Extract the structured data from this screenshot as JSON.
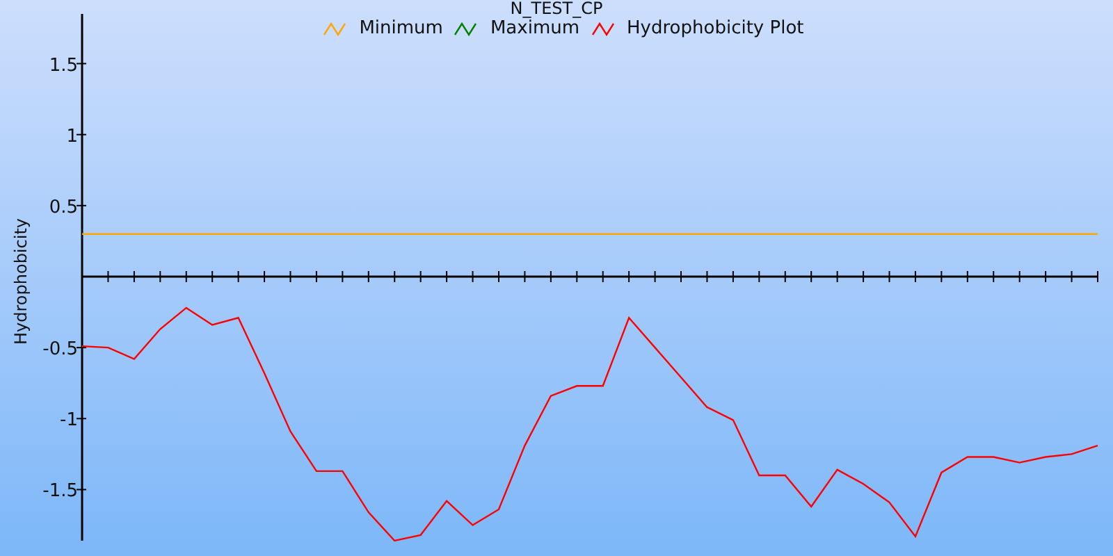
{
  "chart": {
    "chart_data": {
      "type": "line",
      "title": "N_TEST_CP",
      "ylabel": "Hydrophobicity",
      "categories": [
        null,
        null,
        null,
        null,
        null,
        null,
        null,
        null,
        null,
        null,
        null,
        null,
        null,
        null,
        null,
        null,
        null,
        null,
        null,
        null,
        null,
        null,
        null,
        null,
        null,
        null,
        null,
        null,
        null,
        null,
        null,
        null,
        null,
        null,
        null,
        null,
        null,
        null,
        null,
        null
      ],
      "ylim": [
        -1.86,
        1.85
      ],
      "yticks": [
        {
          "value": -1.5,
          "label": "-1.5"
        },
        {
          "value": -1,
          "label": "-1"
        },
        {
          "value": -0.5,
          "label": "-0.5"
        },
        {
          "value": 0.5,
          "label": "0.5"
        },
        {
          "value": 1,
          "label": "1"
        },
        {
          "value": 1.5,
          "label": "1.5"
        }
      ],
      "series": [
        {
          "name": "Minimum",
          "color": "#ffa500",
          "values": [
            0.3,
            0.3,
            0.3,
            0.3,
            0.3,
            0.3,
            0.3,
            0.3,
            0.3,
            0.3,
            0.3,
            0.3,
            0.3,
            0.3,
            0.3,
            0.3,
            0.3,
            0.3,
            0.3,
            0.3,
            0.3,
            0.3,
            0.3,
            0.3,
            0.3,
            0.3,
            0.3,
            0.3,
            0.3,
            0.3,
            0.3,
            0.3,
            0.3,
            0.3,
            0.3,
            0.3,
            0.3,
            0.3,
            0.3,
            0.3
          ]
        },
        {
          "name": "Maximum",
          "color": "#008000",
          "values": [
            null,
            null,
            null,
            null,
            null,
            null,
            null,
            null,
            null,
            null,
            null,
            null,
            null,
            null,
            null,
            null,
            null,
            null,
            null,
            null,
            null,
            null,
            null,
            null,
            null,
            null,
            null,
            null,
            null,
            null,
            null,
            null,
            null,
            null,
            null,
            null,
            null,
            null,
            null,
            null
          ]
        },
        {
          "name": "Hydrophobicity Plot",
          "color": "#ff0000",
          "values": [
            -0.49,
            -0.5,
            -0.58,
            -0.37,
            -0.22,
            -0.34,
            -0.29,
            -0.68,
            -1.09,
            -1.37,
            -1.37,
            -1.66,
            -1.86,
            -1.82,
            -1.58,
            -1.75,
            -1.64,
            -1.19,
            -0.84,
            -0.77,
            -0.77,
            -0.29,
            -0.5,
            -0.71,
            -0.92,
            -1.01,
            -1.4,
            -1.4,
            -1.62,
            -1.36,
            -1.46,
            -1.59,
            -1.83,
            -1.38,
            -1.27,
            -1.27,
            -1.31,
            -1.27,
            -1.25,
            -1.19
          ]
        }
      ]
    }
  }
}
